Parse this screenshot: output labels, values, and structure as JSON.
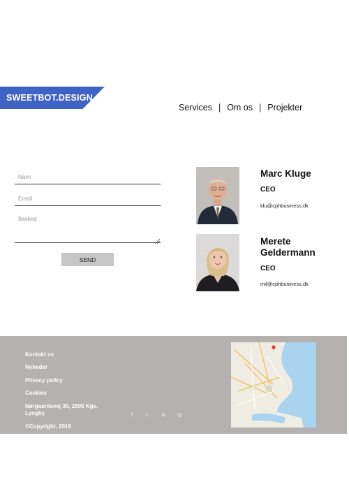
{
  "logo": {
    "text": "SWEETBOT.DESIGN"
  },
  "nav": {
    "items": [
      "Services",
      "Om os",
      "Projekter"
    ],
    "separator": "|"
  },
  "form": {
    "name_placeholder": "Navn",
    "email_placeholder": "Email",
    "message_placeholder": "Besked",
    "send_label": "SEND"
  },
  "people": [
    {
      "name": "Marc Kluge",
      "role": "CEO",
      "email": "klu@cphbusiness.dk",
      "photo_icon": "portrait-man-icon"
    },
    {
      "name": "Merete Geldermann",
      "role": "CEO",
      "email": "mil@cphbusiness.dk",
      "photo_icon": "portrait-woman-icon"
    }
  ],
  "footer": {
    "links": [
      "Kontakt os",
      "Nyheder",
      "Privacy policy",
      "Cookies"
    ],
    "address": "Nørgaardsvej 30, 2800 Kgs. Lyngby",
    "copyright": "©Copyright, 2018",
    "social": [
      {
        "icon": "facebook-icon",
        "glyph": "f"
      },
      {
        "icon": "twitter-icon",
        "glyph": "t"
      },
      {
        "icon": "linkedin-icon",
        "glyph": "in"
      },
      {
        "icon": "instagram-icon",
        "glyph": "◎"
      }
    ],
    "map_icon": "map-icon"
  },
  "colors": {
    "logo_bg": "#3f63c4",
    "footer_bg": "#b4b1ae",
    "send_bg": "#c6c6c6",
    "map_water": "#a9d3ee",
    "map_marker": "#e0342e"
  }
}
